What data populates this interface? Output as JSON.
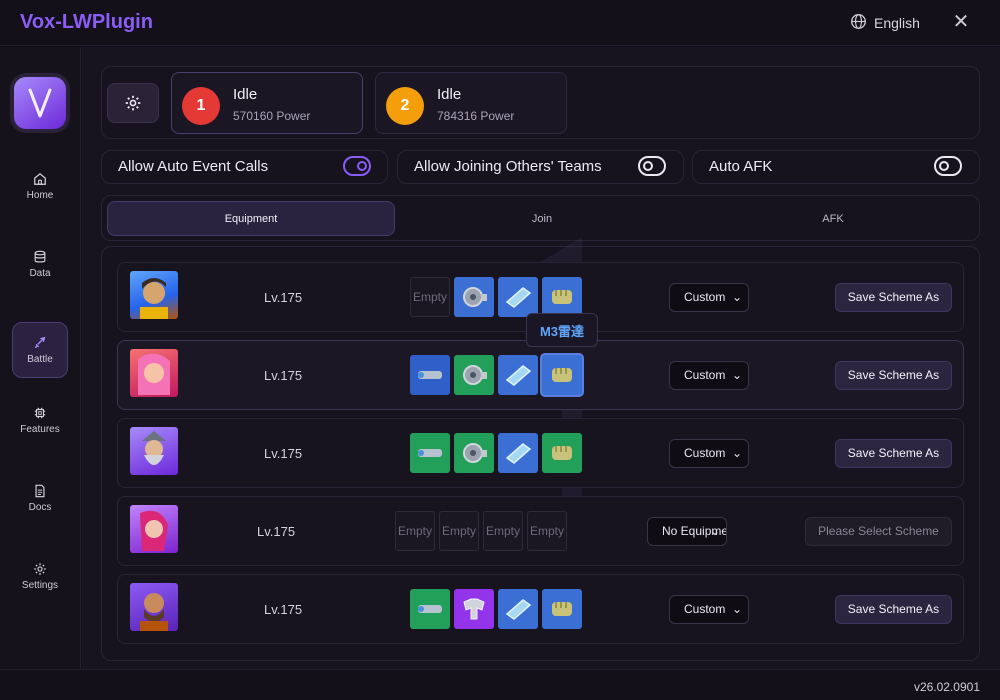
{
  "app": {
    "title": "Vox-LWPlugin",
    "language": "English"
  },
  "sidebar": {
    "items": [
      {
        "label": "Home",
        "icon": "home-icon"
      },
      {
        "label": "Data",
        "icon": "database-icon"
      },
      {
        "label": "Battle",
        "icon": "sword-icon",
        "active": true
      },
      {
        "label": "Features",
        "icon": "chip-icon"
      },
      {
        "label": "Docs",
        "icon": "document-icon"
      },
      {
        "label": "Settings",
        "icon": "gear-icon"
      }
    ]
  },
  "status": [
    {
      "num": "1",
      "title": "Idle",
      "power": "570160 Power",
      "color": "#ef4444"
    },
    {
      "num": "2",
      "title": "Idle",
      "power": "784316 Power",
      "color": "#f59e0b"
    }
  ],
  "toggles": [
    {
      "label": "Allow Auto Event Calls",
      "on": true
    },
    {
      "label": "Allow Joining Others' Teams",
      "on": false
    },
    {
      "label": "Auto AFK",
      "on": false
    }
  ],
  "tabs": [
    "Equipment",
    "Join",
    "AFK"
  ],
  "heroes": [
    {
      "level": "Lv.175",
      "slots": [
        "Empty",
        "gear",
        "plate",
        "fist"
      ],
      "scheme": "Custom",
      "action": "Save Scheme As",
      "avatar_bg": "#3b82f6"
    },
    {
      "level": "Lv.175",
      "slots": [
        "binoculars",
        "gear",
        "plate",
        "fist"
      ],
      "scheme": "Custom",
      "action": "Save Scheme As",
      "avatar_bg": "#ef4444"
    },
    {
      "level": "Lv.175",
      "slots": [
        "binoculars",
        "gear",
        "plate",
        "fist"
      ],
      "scheme": "Custom",
      "action": "Save Scheme As",
      "avatar_bg": "#8b5cf6"
    },
    {
      "level": "Lv.175",
      "slots": [
        "Empty",
        "Empty",
        "Empty",
        "Empty"
      ],
      "scheme": "No Equipment",
      "action": "Please Select Scheme",
      "avatar_bg": "#a855f7"
    },
    {
      "level": "Lv.175",
      "slots": [
        "binoculars",
        "armor",
        "plate",
        "fist"
      ],
      "scheme": "Custom",
      "action": "Save Scheme As",
      "avatar_bg": "#7c3aed"
    }
  ],
  "tooltip": "M3雷達",
  "version": "v26.02.0901"
}
